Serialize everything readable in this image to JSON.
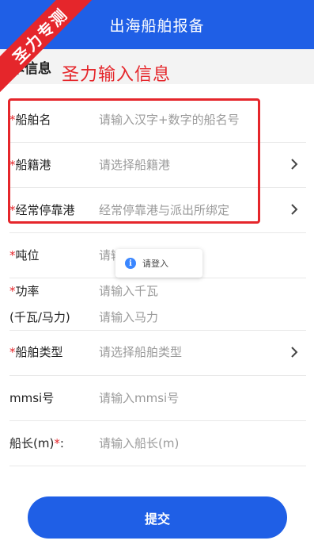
{
  "header": {
    "title": "出海船舶报备"
  },
  "watermark": {
    "banner_text": "圣力专测"
  },
  "section": {
    "title": "本信息",
    "overlay_note": "圣力输入信息"
  },
  "fields": [
    {
      "label": "船舶名",
      "required": "*",
      "placeholder": "请输入汉字+数字的船名号",
      "has_chevron": false
    },
    {
      "label": "船籍港",
      "required": "*",
      "placeholder": "请选择船籍港",
      "has_chevron": true
    },
    {
      "label": "经常停靠港",
      "required": "*",
      "placeholder": "经常停靠港与派出所绑定",
      "has_chevron": true
    },
    {
      "label": "吨位",
      "required": "*",
      "placeholder": "请输入吨位",
      "has_chevron": false
    },
    {
      "label": "功率",
      "required": "*",
      "label2": "(千瓦/马力)",
      "placeholder": "请输入千瓦",
      "placeholder2": "请输入马力",
      "has_chevron": false
    },
    {
      "label": "船舶类型",
      "required": "*",
      "placeholder": "请选择船舶类型",
      "has_chevron": true
    },
    {
      "label": "mmsi号",
      "required": "",
      "placeholder": "请输入mmsi号",
      "has_chevron": false
    },
    {
      "label": "船长(m)",
      "required": "*",
      "suffix": ":",
      "placeholder": "请输入船长(m)",
      "has_chevron": false
    }
  ],
  "toast": {
    "icon": "info-icon",
    "text": "请登入"
  },
  "submit": {
    "label": "提交"
  },
  "colors": {
    "primary": "#1f5fe6",
    "accent_red": "#e5262b",
    "placeholder": "#9a9a9a"
  }
}
